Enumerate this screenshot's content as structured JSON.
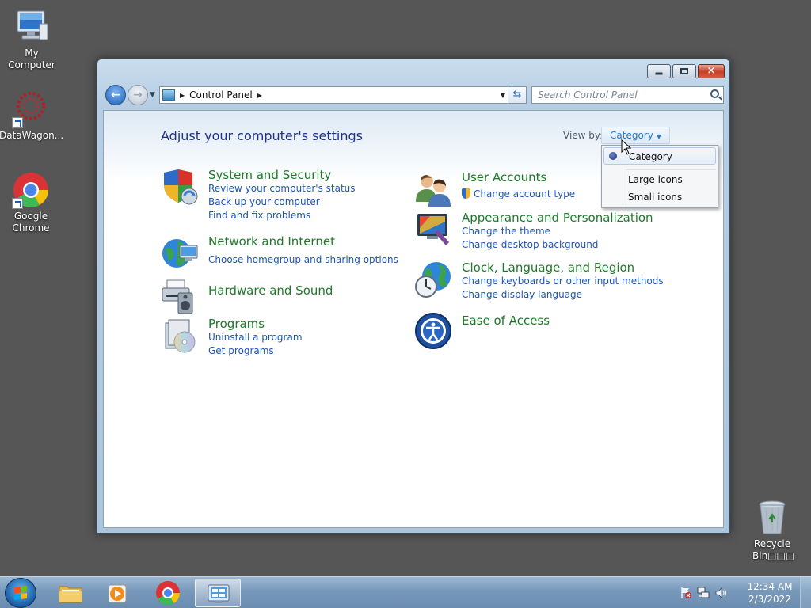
{
  "desktop": {
    "icons": [
      {
        "label": "My Computer"
      },
      {
        "label": "DataWagon..."
      },
      {
        "label": "Google Chrome"
      },
      {
        "label": "Recycle Bin□□□"
      }
    ]
  },
  "window": {
    "address": {
      "crumb": "Control Panel"
    },
    "search": {
      "placeholder": "Search Control Panel"
    },
    "heading": "Adjust your computer's settings",
    "view_by": {
      "label": "View by:",
      "value": "Category"
    },
    "view_menu": {
      "options": [
        "Category",
        "Large icons",
        "Small icons"
      ],
      "selected": "Category"
    },
    "categories": {
      "left": [
        {
          "title": "System and Security",
          "icon": "shield-icon",
          "links": [
            "Review your computer's status",
            "Back up your computer",
            "Find and fix problems"
          ]
        },
        {
          "title": "Network and Internet",
          "icon": "network-globe-icon",
          "links": [
            "Choose homegroup and sharing options"
          ]
        },
        {
          "title": "Hardware and Sound",
          "icon": "printer-speaker-icon",
          "links": []
        },
        {
          "title": "Programs",
          "icon": "programs-disc-icon",
          "links": [
            "Uninstall a program",
            "Get programs"
          ]
        }
      ],
      "right": [
        {
          "title": "User Accounts",
          "icon": "users-icon",
          "links": [
            "Change account type"
          ]
        },
        {
          "title": "Appearance and Personalization",
          "icon": "monitor-paint-icon",
          "links": [
            "Change the theme",
            "Change desktop background"
          ]
        },
        {
          "title": "Clock, Language, and Region",
          "icon": "clock-globe-icon",
          "links": [
            "Change keyboards or other input methods",
            "Change display language"
          ]
        },
        {
          "title": "Ease of Access",
          "icon": "ease-of-access-icon",
          "links": []
        }
      ]
    }
  },
  "taskbar": {
    "clock": {
      "time": "12:34 AM",
      "date": "2/3/2022"
    }
  },
  "colors": {
    "category_title": "#1e7a28",
    "link": "#1e56b8",
    "heading": "#1e3287",
    "desktop": "#565656"
  }
}
